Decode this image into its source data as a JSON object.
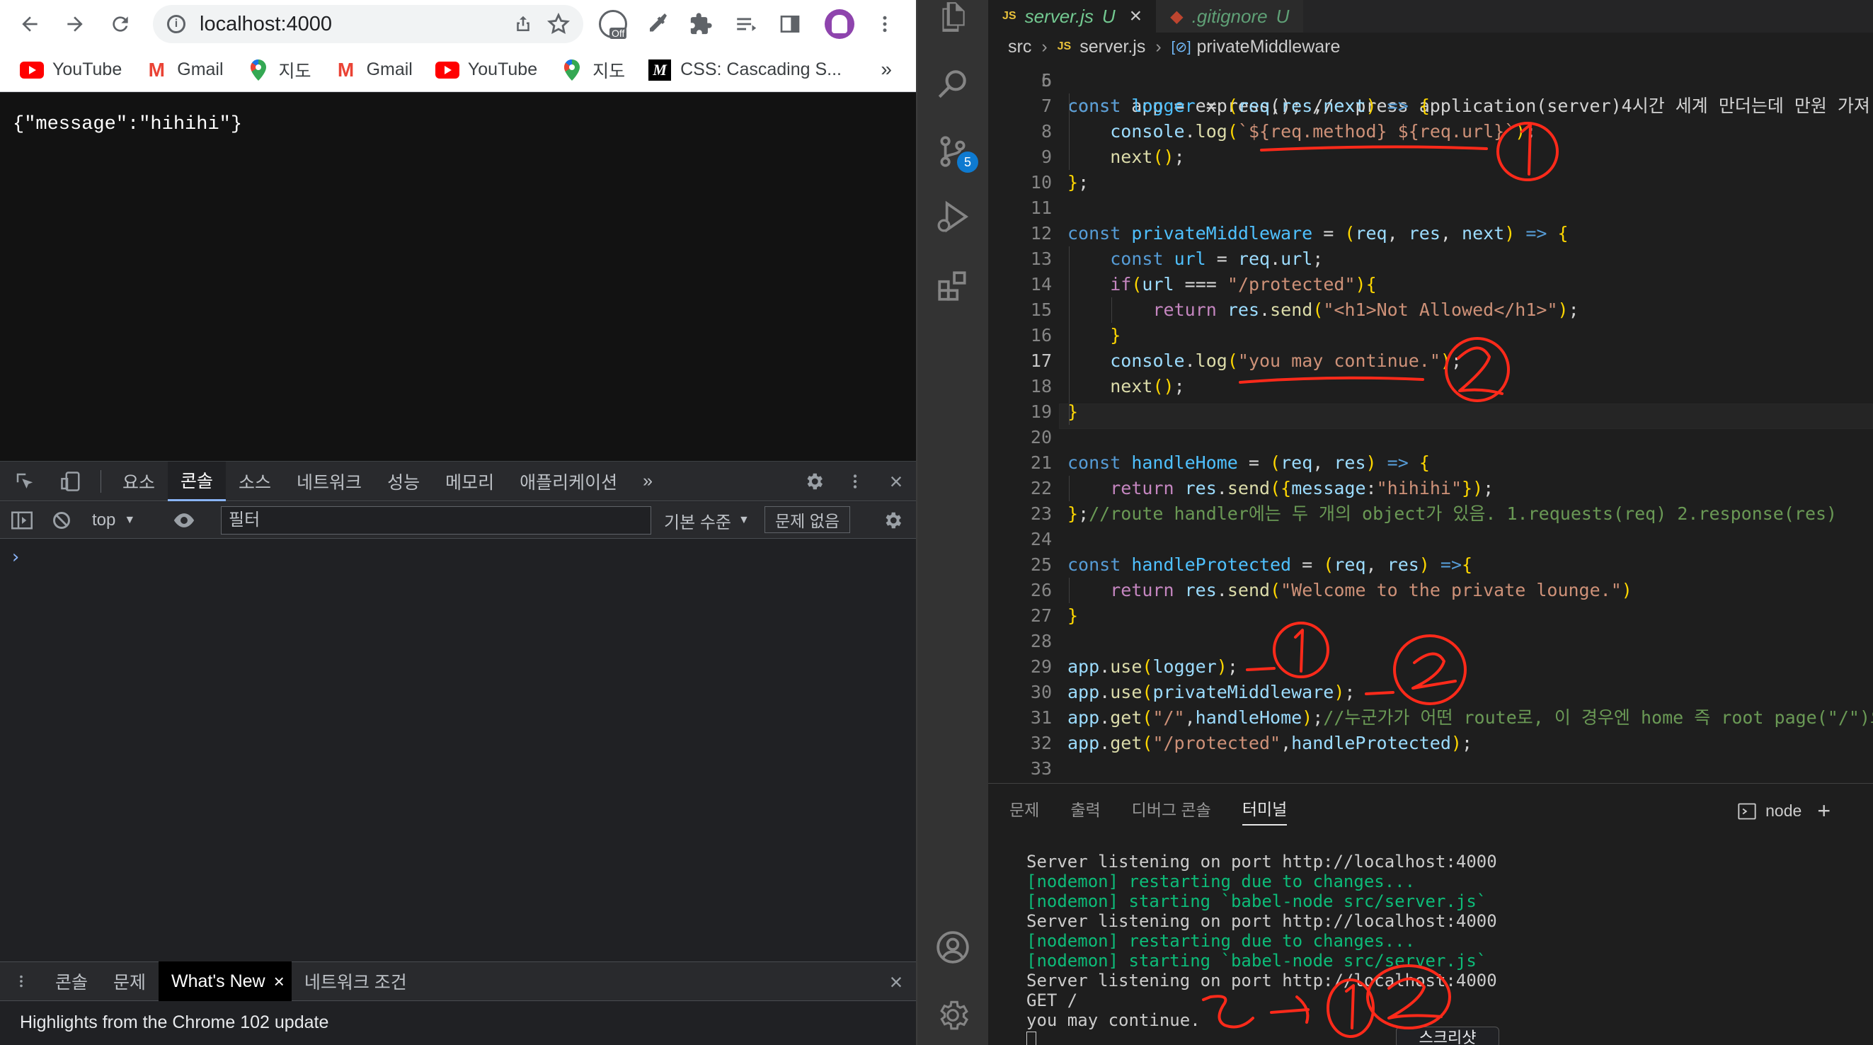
{
  "browser": {
    "url": "localhost:4000",
    "bookmarks": [
      {
        "icon": "youtube-icon",
        "label": "YouTube"
      },
      {
        "icon": "gmail-icon",
        "label": "Gmail"
      },
      {
        "icon": "maps-icon",
        "label": "지도"
      },
      {
        "icon": "gmail-icon",
        "label": "Gmail"
      },
      {
        "icon": "youtube-icon",
        "label": "YouTube"
      },
      {
        "icon": "maps-icon",
        "label": "지도"
      },
      {
        "icon": "mdn-icon",
        "label": "CSS: Cascading S..."
      }
    ],
    "bookmarks_more": "»",
    "extension_off_label": "Off",
    "page_text": "{\"message\":\"hihihi\"}"
  },
  "devtools": {
    "tabs": [
      "요소",
      "콘솔",
      "소스",
      "네트워크",
      "성능",
      "메모리",
      "애플리케이션"
    ],
    "more_tabs": "»",
    "context": "top",
    "filter_placeholder": "필터",
    "levels": "기본 수준",
    "issues": "문제 없음",
    "prompt": "›",
    "drawer_tabs": [
      "콘솔",
      "문제",
      "What's New",
      "네트워크 조건"
    ],
    "drawer_close": "×",
    "highlights": "Highlights from the Chrome 102 update",
    "screenshot_tooltip": "스크리샷"
  },
  "vscode": {
    "scm_badge": "5",
    "tabs": [
      {
        "icon": "JS",
        "name": "server.js",
        "status": "U",
        "close": "×"
      },
      {
        "icon": "◆",
        "name": ".gitignore",
        "status": "U"
      }
    ],
    "breadcrumb": [
      "src",
      "server.js",
      "privateMiddleware"
    ],
    "breadcrumb_js": "JS",
    "breadcrumb_symbol": "[⊘]",
    "code_partial_line": "const app = express(); //express application(server)4시간 세계 만더는데 만원 가져",
    "lines": [
      {
        "n": "6",
        "t": ""
      },
      {
        "n": "7",
        "t": "const logger = (req,res,next) => {"
      },
      {
        "n": "8",
        "t": "    console.log(`${req.method} ${req.url}`);"
      },
      {
        "n": "9",
        "t": "    next();"
      },
      {
        "n": "10",
        "t": "};"
      },
      {
        "n": "11",
        "t": ""
      },
      {
        "n": "12",
        "t": "const privateMiddleware = (req, res, next) => {"
      },
      {
        "n": "13",
        "t": "    const url = req.url;"
      },
      {
        "n": "14",
        "t": "    if(url === \"/protected\"){"
      },
      {
        "n": "15",
        "t": "        return res.send(\"<h1>Not Allowed</h1>\");"
      },
      {
        "n": "16",
        "t": "    }"
      },
      {
        "n": "17",
        "t": "    console.log(\"you may continue.\");"
      },
      {
        "n": "18",
        "t": "    next();"
      },
      {
        "n": "19",
        "t": "}"
      },
      {
        "n": "20",
        "t": ""
      },
      {
        "n": "21",
        "t": "const handleHome = (req, res) => {"
      },
      {
        "n": "22",
        "t": "    return res.send({message:\"hihihi\"});"
      },
      {
        "n": "23",
        "t": "};//route handler에는 두 개의 object가 있음. 1.requests(req) 2.response(res)"
      },
      {
        "n": "24",
        "t": ""
      },
      {
        "n": "25",
        "t": "const handleProtected = (req, res) =>{"
      },
      {
        "n": "26",
        "t": "    return res.send(\"Welcome to the private lounge.\")"
      },
      {
        "n": "27",
        "t": "}"
      },
      {
        "n": "28",
        "t": ""
      },
      {
        "n": "29",
        "t": "app.use(logger);"
      },
      {
        "n": "30",
        "t": "app.use(privateMiddleware);"
      },
      {
        "n": "31",
        "t": "app.get(\"/\",handleHome);//누군가가 어떤 route로, 이 경우엔 home 즉 root page(\"/\")으로"
      },
      {
        "n": "32",
        "t": "app.get(\"/protected\",handleProtected);"
      },
      {
        "n": "33",
        "t": ""
      }
    ],
    "current_line": "17",
    "panel_tabs": [
      "문제",
      "출력",
      "디버그 콘솔",
      "터미널"
    ],
    "active_panel_tab": "터미널",
    "terminal_name": "node",
    "terminal_add": "+",
    "terminal_lines": [
      {
        "text": "Server listening on port http://localhost:4000",
        "color": "#cccccc"
      },
      {
        "text": "[nodemon] restarting due to changes...",
        "color": "#0dbc79"
      },
      {
        "text": "[nodemon] starting `babel-node src/server.js`",
        "color": "#0dbc79"
      },
      {
        "text": "Server listening on port http://localhost:4000",
        "color": "#cccccc"
      },
      {
        "text": "[nodemon] restarting due to changes...",
        "color": "#0dbc79"
      },
      {
        "text": "[nodemon] starting `babel-node src/server.js`",
        "color": "#0dbc79"
      },
      {
        "text": "Server listening on port http://localhost:4000",
        "color": "#cccccc"
      },
      {
        "text": "GET /",
        "color": "#cccccc"
      },
      {
        "text": "you may continue.",
        "color": "#cccccc"
      }
    ]
  },
  "colors": {
    "annotation_red": "#ff2a1a",
    "active_tab_accent": "#8ab4f8",
    "terminal_green": "#0dbc79",
    "untracked_green": "#73c991"
  }
}
